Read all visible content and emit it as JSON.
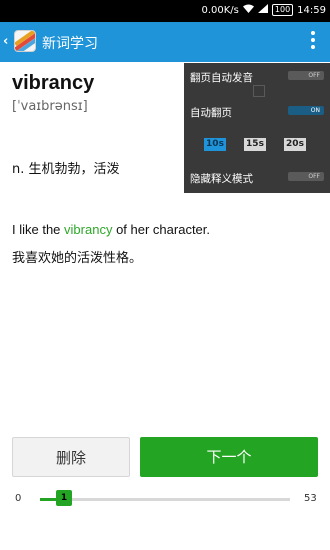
{
  "status_bar": {
    "network_speed": "0.00K/s",
    "battery": "100",
    "time": "14:59",
    "wifi_icon": "wifi-icon",
    "signal_icon": "signal-icon"
  },
  "action_bar": {
    "title": "新词学习",
    "back_icon": "back-chevron-icon",
    "menu_icon": "overflow-menu-icon"
  },
  "card": {
    "word": "vibrancy",
    "phonetic": "[ˈvaɪbrənsɪ]",
    "definition": "n. 生机勃勃，活泼",
    "example": {
      "before": "I like the ",
      "highlight": "vibrancy",
      "after": " of her character.",
      "translation": "我喜欢她的活泼性格。"
    },
    "highlight_color": "#2ea82a"
  },
  "settings_popup": {
    "auto_pronounce_label": "翻页自动发音",
    "auto_pronounce_state": "OFF",
    "auto_page_label": "自动翻页",
    "auto_page_state": "ON",
    "intervals": [
      "10s",
      "15s",
      "20s"
    ],
    "selected_interval": "10s",
    "hide_definition_label": "隐藏释义模式",
    "hide_definition_state": "OFF"
  },
  "buttons": {
    "delete_label": "删除",
    "next_label": "下一个"
  },
  "progress": {
    "min": "0",
    "max": "53",
    "current": "1",
    "fraction": 0.019
  },
  "colors": {
    "accent": "#1f94d9",
    "primary_button": "#23a523"
  }
}
